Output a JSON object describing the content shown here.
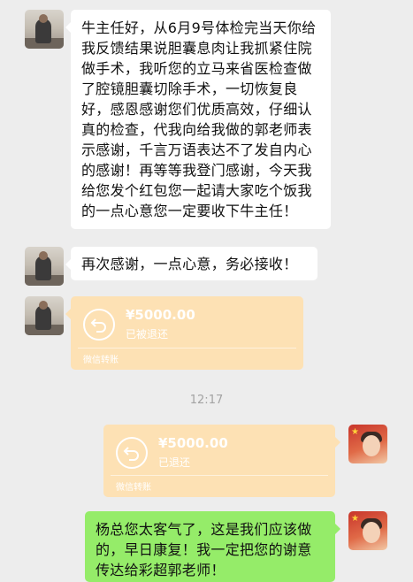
{
  "messages": [
    {
      "text": "牛主任好，从6月9号体检完当天你给我反馈结果说胆囊息肉让我抓紧住院做手术，我听您的立马来省医检查做了腔镜胆囊切除手术，一切恢复良好，感恩感谢您们优质高效，仔细认真的检查，代我向给我做的郭老师表示感谢，千言万语表达不了发自内心的感谢！再等等我登门感谢，今天我给您发个红包您一起请大家吃个饭我的一点心意您一定要收下牛主任！"
    },
    {
      "text": "再次感谢，一点心意，务必接收！"
    }
  ],
  "transfer_in": {
    "amount": "¥5000.00",
    "status": "已被退还",
    "footer": "微信转账"
  },
  "time": "12:17",
  "transfer_out": {
    "amount": "¥5000.00",
    "status": "已退还",
    "footer": "微信转账"
  },
  "reply": {
    "text": "杨总您太客气了，这是我们应该做的，早日康复！我一定把您的谢意传达给彩超郭老师！"
  },
  "colors": {
    "background": "#ededed",
    "bubble_white": "#ffffff",
    "bubble_green": "#95ec69",
    "transfer": "#fde1b4"
  }
}
